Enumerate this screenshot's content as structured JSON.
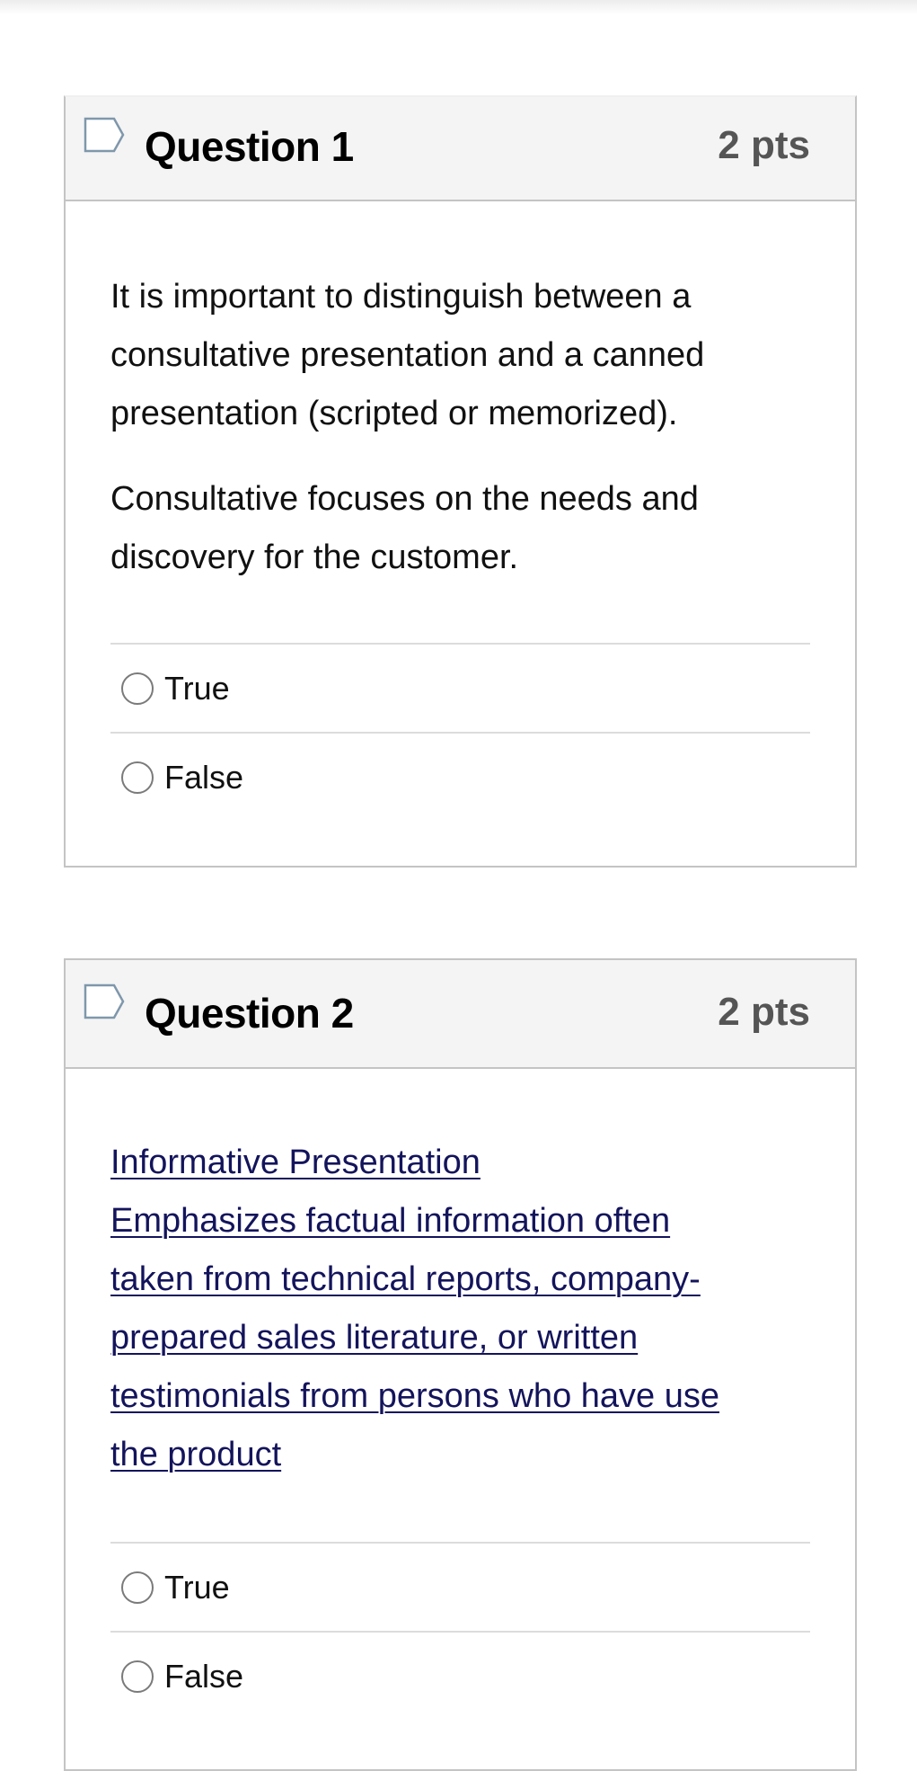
{
  "questions": [
    {
      "title": "Question 1",
      "points": "2 pts",
      "flag_icon": "flag-outline-icon",
      "text_style": "plain",
      "paragraphs": [
        [
          "It is important to distinguish between a",
          "consultative presentation and a canned",
          "presentation (scripted or memorized)."
        ],
        [
          "Consultative focuses on the needs and",
          "discovery for the customer."
        ]
      ],
      "answers": [
        {
          "label": "True",
          "selected": false
        },
        {
          "label": "False",
          "selected": false
        }
      ]
    },
    {
      "title": "Question 2",
      "points": "2 pts",
      "flag_icon": "flag-outline-icon",
      "text_style": "link",
      "link_color": "#14145c",
      "paragraphs": [
        [
          "Informative Presentation",
          "Emphasizes factual information often",
          "taken from technical reports, company-",
          "prepared sales literature, or written",
          "testimonials from persons who have use",
          "the product"
        ]
      ],
      "answers": [
        {
          "label": "True",
          "selected": false
        },
        {
          "label": "False",
          "selected": false
        }
      ]
    }
  ]
}
